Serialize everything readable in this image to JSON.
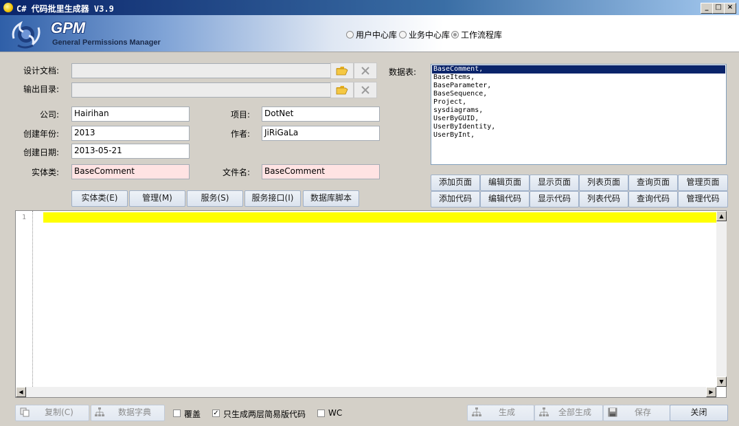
{
  "window": {
    "title": "C# 代码批里生成器 V3.9"
  },
  "banner": {
    "logo_main": "GPM",
    "logo_sub": "General Permissions Manager"
  },
  "databases": [
    {
      "label": "用户中心库",
      "selected": false
    },
    {
      "label": "业务中心库",
      "selected": false
    },
    {
      "label": "工作流程库",
      "selected": true
    }
  ],
  "form": {
    "design_doc_label": "设计文档:",
    "design_doc_value": "",
    "output_dir_label": "输出目录:",
    "output_dir_value": "",
    "company_label": "公司:",
    "company_value": "Hairihan",
    "project_label": "项目:",
    "project_value": "DotNet",
    "year_label": "创建年份:",
    "year_value": "2013",
    "author_label": "作者:",
    "author_value": "JiRiGaLa",
    "date_label": "创建日期:",
    "date_value": "2013-05-21",
    "entity_label": "实体类:",
    "entity_value": "BaseComment",
    "filename_label": "文件名:",
    "filename_value": "BaseComment"
  },
  "gen_buttons": [
    "实体类(E)",
    "管理(M)",
    "服务(S)",
    "服务接口(I)",
    "数据库脚本"
  ],
  "tables": {
    "label": "数据表:",
    "items": [
      "BaseComment,",
      "BaseItems,",
      "BaseParameter,",
      "BaseSequence,",
      "Project,",
      "sysdiagrams,",
      "UserByGUID,",
      "UserByIdentity,",
      "UserByInt,"
    ],
    "selected_index": 0
  },
  "page_buttons": [
    "添加页面",
    "编辑页面",
    "显示页面",
    "列表页面",
    "查询页面",
    "管理页面"
  ],
  "code_buttons": [
    "添加代码",
    "编辑代码",
    "显示代码",
    "列表代码",
    "查询代码",
    "管理代码"
  ],
  "editor": {
    "line_number": "1"
  },
  "bottom": {
    "copy_label": "复制(C)",
    "dict_label": "数据字典",
    "overwrite_label": "覆盖",
    "overwrite_checked": false,
    "simple_label": "只生成两层简易版代码",
    "simple_checked": true,
    "wc_label": "WC",
    "wc_checked": false,
    "generate_label": "生成",
    "generate_all_label": "全部生成",
    "save_label": "保存",
    "close_label": "关闭"
  }
}
